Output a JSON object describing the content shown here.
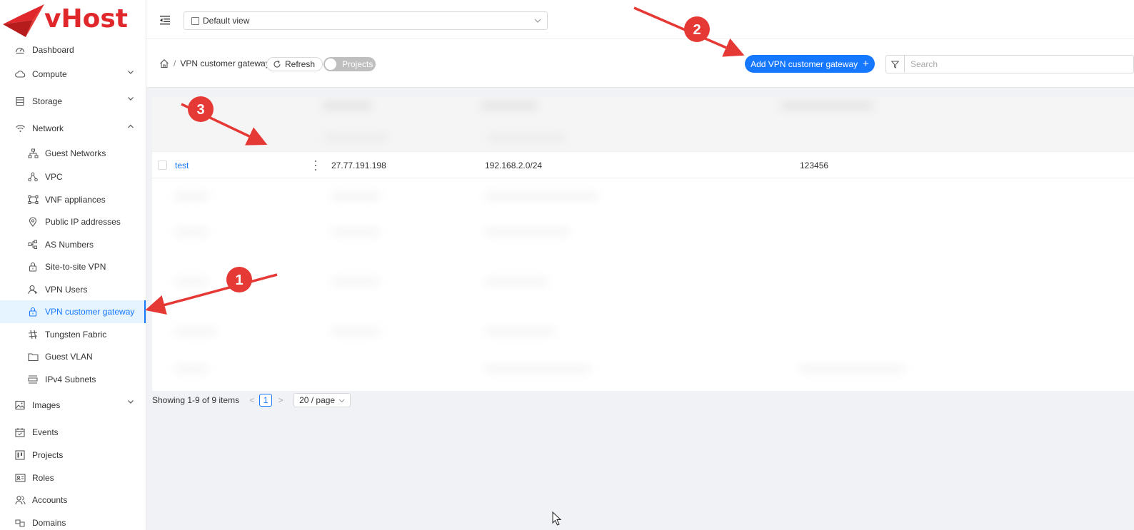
{
  "brand": {
    "logo_text": "vHost",
    "color": "#e0282c"
  },
  "topbar": {
    "view_select": "Default view"
  },
  "sidebar": {
    "items": [
      {
        "label": "Dashboard",
        "icon": "dashboard-icon"
      },
      {
        "label": "Compute",
        "icon": "cloud-icon",
        "expandable": true
      },
      {
        "label": "Storage",
        "icon": "storage-icon",
        "expandable": true
      },
      {
        "label": "Network",
        "icon": "wifi-icon",
        "expandable": true,
        "expanded": true
      },
      {
        "label": "Guest Networks",
        "icon": "network-tree-icon",
        "sub": true
      },
      {
        "label": "VPC",
        "icon": "vpc-icon",
        "sub": true
      },
      {
        "label": "VNF appliances",
        "icon": "vnf-icon",
        "sub": true
      },
      {
        "label": "Public IP addresses",
        "icon": "location-pin-icon",
        "sub": true
      },
      {
        "label": "AS Numbers",
        "icon": "as-numbers-icon",
        "sub": true
      },
      {
        "label": "Site-to-site VPN",
        "icon": "lock-icon",
        "sub": true
      },
      {
        "label": "VPN Users",
        "icon": "user-icon",
        "sub": true
      },
      {
        "label": "VPN customer gateway",
        "icon": "lock-icon",
        "sub": true,
        "active": true
      },
      {
        "label": "Tungsten Fabric",
        "icon": "tungsten-icon",
        "sub": true
      },
      {
        "label": "Guest VLAN",
        "icon": "folder-icon",
        "sub": true
      },
      {
        "label": "IPv4 Subnets",
        "icon": "subnets-icon",
        "sub": true
      },
      {
        "label": "Images",
        "icon": "image-icon",
        "expandable": true
      },
      {
        "label": "Events",
        "icon": "calendar-icon"
      },
      {
        "label": "Projects",
        "icon": "projects-icon"
      },
      {
        "label": "Roles",
        "icon": "id-card-icon"
      },
      {
        "label": "Accounts",
        "icon": "team-icon"
      },
      {
        "label": "Domains",
        "icon": "domains-icon"
      }
    ]
  },
  "header": {
    "breadcrumb_sep": "/",
    "breadcrumb_current": "VPN customer gateway",
    "refresh_label": "Refresh",
    "projects_toggle": "Projects",
    "add_button": "Add VPN customer gateway",
    "add_plus": "+",
    "search_placeholder": "Search"
  },
  "table": {
    "row": {
      "name": "test",
      "gateway": "27.77.191.198",
      "cidr": "192.168.2.0/24",
      "psk": "123456"
    }
  },
  "pagination": {
    "summary": "Showing 1-9 of 9 items",
    "prev": "<",
    "page": "1",
    "next": ">",
    "page_size": "20 / page"
  },
  "annotations": [
    {
      "number": "1"
    },
    {
      "number": "2"
    },
    {
      "number": "3"
    }
  ],
  "colors": {
    "accent": "#1677ff",
    "annotation": "#e53935"
  }
}
